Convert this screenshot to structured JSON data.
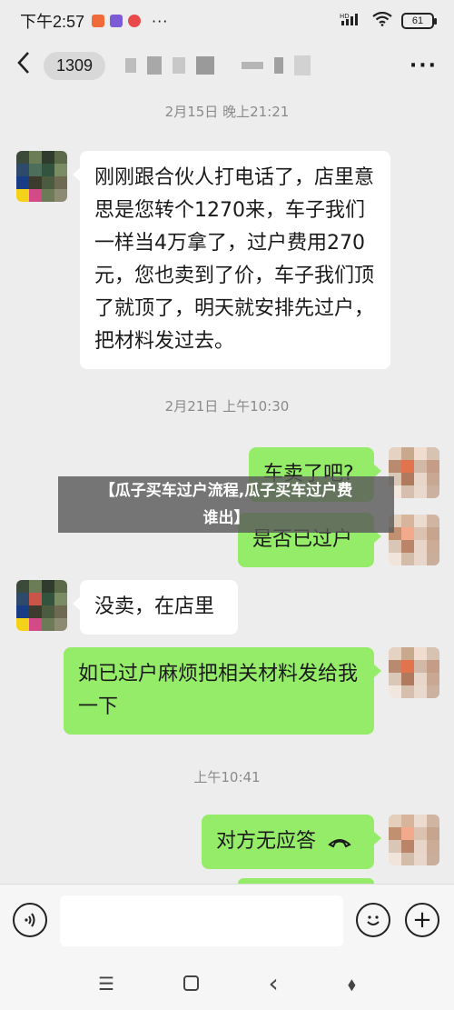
{
  "status_bar": {
    "time": "下午2:57",
    "more": "···",
    "signal_text": "HD",
    "battery": "61"
  },
  "title_bar": {
    "back_icon": "chevron-left-icon",
    "unread_count": "1309",
    "more_icon": "···"
  },
  "messages": [
    {
      "type": "timestamp",
      "text": "2月15日 晚上21:21"
    },
    {
      "type": "in",
      "text": "刚刚跟合伙人打电话了，店里意思是您转个1270来，车子我们一样当4万拿了，过户费用270元，您也卖到了价，车子我们顶了就顶了，明天就安排先过户，把材料发过去。"
    },
    {
      "type": "timestamp",
      "text": "2月21日 上午10:30"
    },
    {
      "type": "out",
      "text": "车卖了吧?"
    },
    {
      "type": "out",
      "text": "是否已过户"
    },
    {
      "type": "in",
      "text": "没卖，在店里"
    },
    {
      "type": "out",
      "text": "如已过户麻烦把相关材料发给我一下"
    },
    {
      "type": "timestamp",
      "text": "上午10:41"
    },
    {
      "type": "out",
      "text": "对方无应答"
    }
  ],
  "overlay": {
    "line1": "【瓜子买车过户流程,瓜子买车过户费",
    "line2": "谁出】"
  },
  "input_bar": {
    "voice_icon": "voice-icon",
    "emoji_icon": "emoji-icon",
    "plus_icon": "+"
  },
  "nav_bar": {
    "menu": "☰",
    "back": "‹",
    "assist": "⬧"
  },
  "colors": {
    "background": "#ededed",
    "bubble_in": "#ffffff",
    "bubble_out": "#95ec69"
  }
}
